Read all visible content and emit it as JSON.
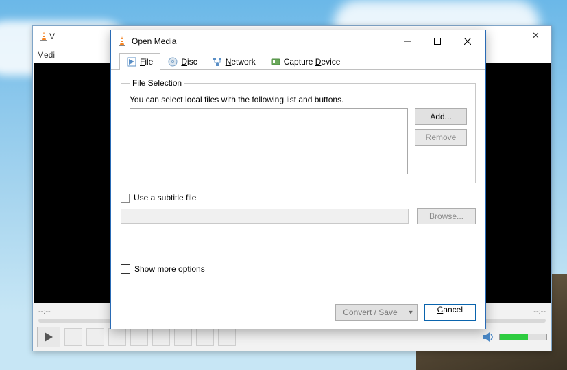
{
  "background_window": {
    "title_prefix": "V",
    "menu_first": "Medi",
    "close_glyph": "✕",
    "time_left": "--:--",
    "time_right": "--:--"
  },
  "dialog": {
    "title": "Open Media",
    "window_buttons": {
      "minimize_label": "Minimize",
      "maximize_label": "Maximize",
      "close_label": "Close"
    },
    "tabs": {
      "file": {
        "prefix": "",
        "ul": "F",
        "suffix": "ile"
      },
      "disc": {
        "prefix": "",
        "ul": "D",
        "suffix": "isc"
      },
      "network": {
        "prefix": "",
        "ul": "N",
        "suffix": "etwork"
      },
      "capture": {
        "prefix": "Capture ",
        "ul": "D",
        "suffix": "evice"
      }
    },
    "file_selection": {
      "legend": "File Selection",
      "help": "You can select local files with the following list and buttons.",
      "add_label": "Add...",
      "remove_label": "Remove"
    },
    "subtitle": {
      "checkbox_label": "Use a subtitle file",
      "browse_label": "Browse...",
      "field_value": ""
    },
    "show_more_label": "Show more options",
    "footer": {
      "convert_label": "Convert / Save",
      "cancel": {
        "prefix": "",
        "ul": "C",
        "suffix": "ancel"
      }
    }
  }
}
